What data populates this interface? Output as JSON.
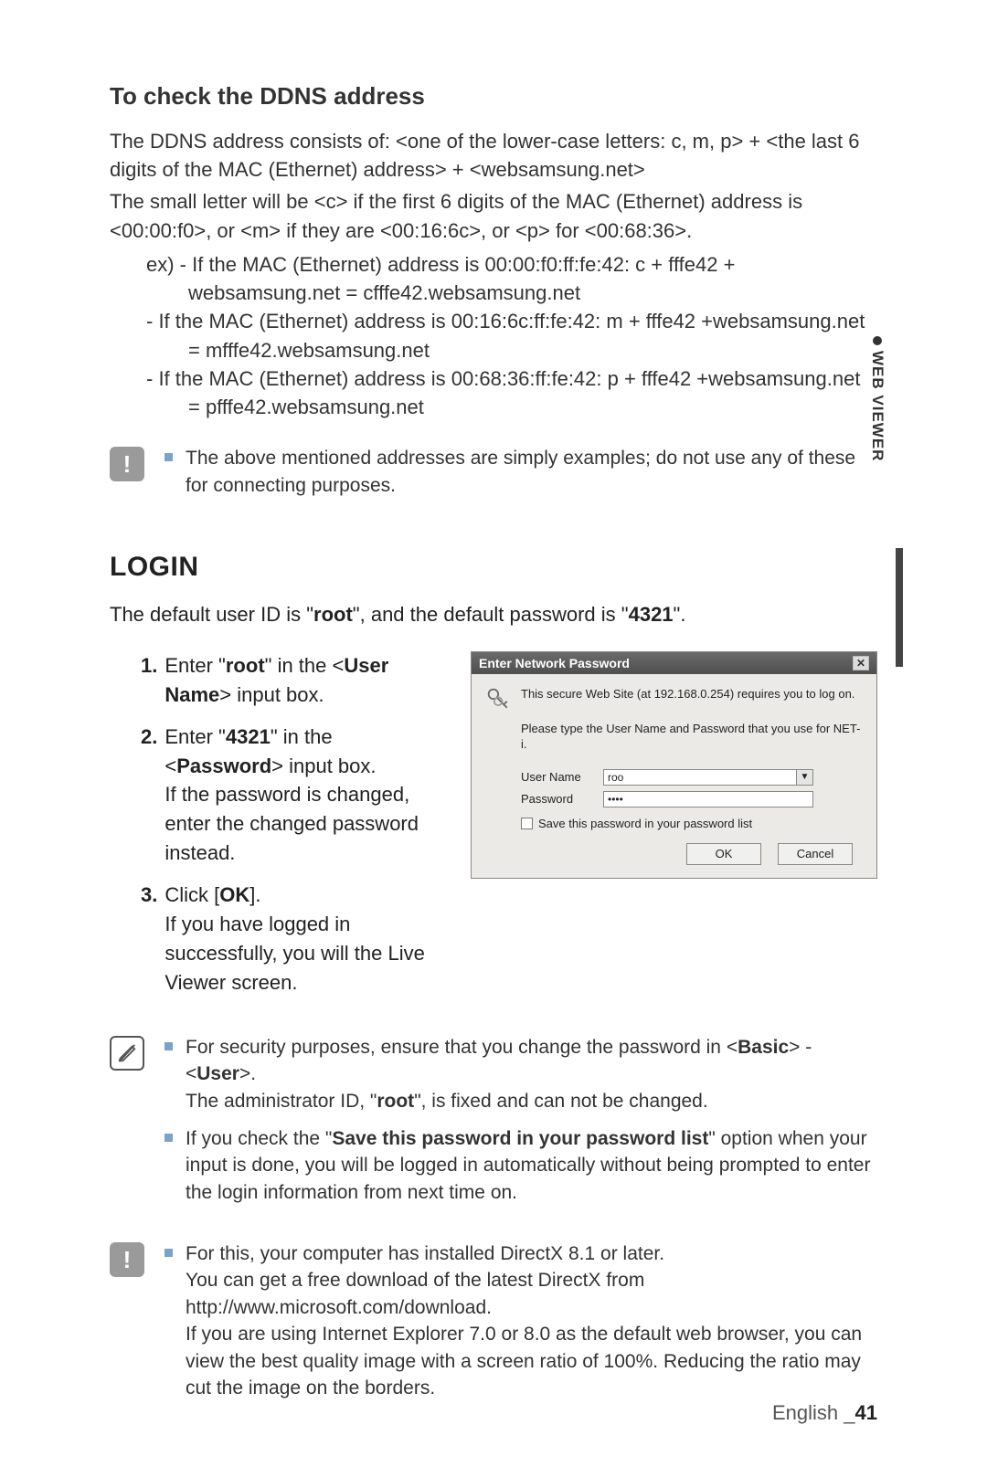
{
  "sideTab": "WEB VIEWER",
  "ddns": {
    "heading": "To check the DDNS address",
    "p1": "The DDNS address consists of: <one of the lower-case letters: c, m, p> + <the last 6 digits of the MAC (Ethernet) address> + <websamsung.net>",
    "p2": "The small letter will be <c> if the first 6 digits of the MAC (Ethernet) address is <00:00:f0>, or <m> if they are <00:16:6c>, or <p> for <00:68:36>.",
    "exIntro": "ex) - If the MAC (Ethernet) address is 00:00:f0:ff:fe:42: c + fffe42 + websamsung.net = cfffe42.websamsung.net",
    "ex2": "- If the MAC (Ethernet) address is 00:16:6c:ff:fe:42: m + fffe42 +websamsung.net = mfffe42.websamsung.net",
    "ex3": "- If the MAC (Ethernet) address is 00:68:36:ff:fe:42: p + fffe42 +websamsung.net = pfffe42.websamsung.net",
    "warn": "The above mentioned addresses are simply examples; do not use any of these for connecting purposes."
  },
  "login": {
    "heading": "LOGIN",
    "intro_pre": "The default user ID is \"",
    "intro_root": "root",
    "intro_mid": "\", and the default password is \"",
    "intro_pw": "4321",
    "intro_post": "\".",
    "steps": {
      "s1_pre": "Enter \"",
      "s1_b1": "root",
      "s1_mid": "\" in the <",
      "s1_b2": "User Name",
      "s1_post": "> input box.",
      "s2_pre": "Enter \"",
      "s2_b1": "4321",
      "s2_mid": "\" in the <",
      "s2_b2": "Password",
      "s2_post": "> input box.",
      "s2_cont": "If the password is changed, enter the changed password instead.",
      "s3_pre": "Click [",
      "s3_b": "OK",
      "s3_post": "].",
      "s3_cont": "If you have logged in successfully, you will the Live Viewer screen."
    },
    "note1_pre": "For security purposes, ensure that you change the password in <",
    "note1_b1": "Basic",
    "note1_mid": "> - <",
    "note1_b2": "User",
    "note1_post": ">.",
    "note1_line2_pre": "The administrator ID, \"",
    "note1_line2_b": "root",
    "note1_line2_post": "\", is fixed and can not be changed.",
    "note2_pre": "If you check the \"",
    "note2_b": "Save this password in your password list",
    "note2_post": "\" option when your input is done, you will be logged in automatically without being prompted to enter the login information from next time on.",
    "warn2": "For this, your computer has installed DirectX 8.1 or later.\nYou can get a free download of the latest DirectX from http://www.microsoft.com/download.\nIf you are using Internet Explorer 7.0 or 8.0 as the default web browser, you can view the best quality image with a screen ratio of 100%. Reducing the ratio may cut the image on the borders."
  },
  "dialog": {
    "title": "Enter Network Password",
    "msg": "This secure Web Site (at 192.168.0.254) requires you to log on.",
    "sub": "Please type the User Name and Password that you use for NET-i.",
    "userLabel": "User Name",
    "userValue": "roo",
    "passLabel": "Password",
    "passValue": "••••",
    "checkLabel": "Save this password in your password list",
    "ok": "OK",
    "cancel": "Cancel"
  },
  "footer": {
    "lang": "English _",
    "page": "41"
  }
}
